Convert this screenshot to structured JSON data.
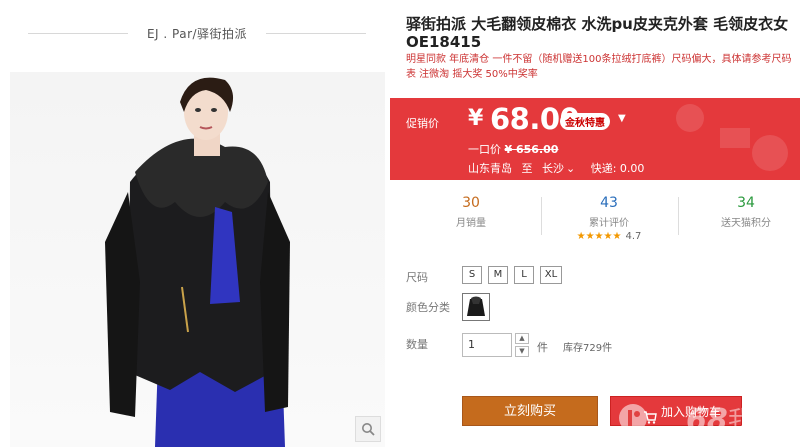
{
  "shop": {
    "name": "EJ . Par/驿街拍派"
  },
  "product": {
    "title": "驿街拍派 大毛翻领皮棉衣 水洗pu皮夹克外套 毛领皮衣女OE18415",
    "subtitle": "明星同款 年底清仓 一件不留（随机赠送100条拉绒打底裤）尺码偏大，具体请参考尺码表 注微淘 摇大奖 50%中奖率"
  },
  "price": {
    "label": "促销价",
    "currency": "¥",
    "value": "68.00",
    "promo_badge": "金秋特惠",
    "original_label": "一口价",
    "original_value": "¥ 656.00",
    "ship_from": "山东青岛",
    "ship_to_label": "至",
    "ship_to": "长沙",
    "shipping_fee": "快递: 0.00"
  },
  "stats": {
    "monthly_sales": {
      "value": "30",
      "label": "月销量"
    },
    "reviews": {
      "value": "43",
      "label": "累计评价",
      "stars": "★★★★★",
      "score": "4.7"
    },
    "points": {
      "value": "34",
      "label": "送天猫积分"
    }
  },
  "options": {
    "size_label": "尺码",
    "sizes": [
      "S",
      "M",
      "L",
      "XL"
    ],
    "color_label": "颜色分类",
    "qty_label": "数量",
    "qty_value": "1",
    "qty_unit": "件",
    "stock": "库存729件"
  },
  "actions": {
    "buy_now": "立刻购买",
    "add_to_cart": "加入购物车"
  },
  "colors": {
    "price_red": "#e4393c",
    "buy_orange": "#c56b1d",
    "sales_color": "#c56b1d",
    "reviews_color": "#2a6ebb",
    "points_color": "#2b9a3e"
  }
}
